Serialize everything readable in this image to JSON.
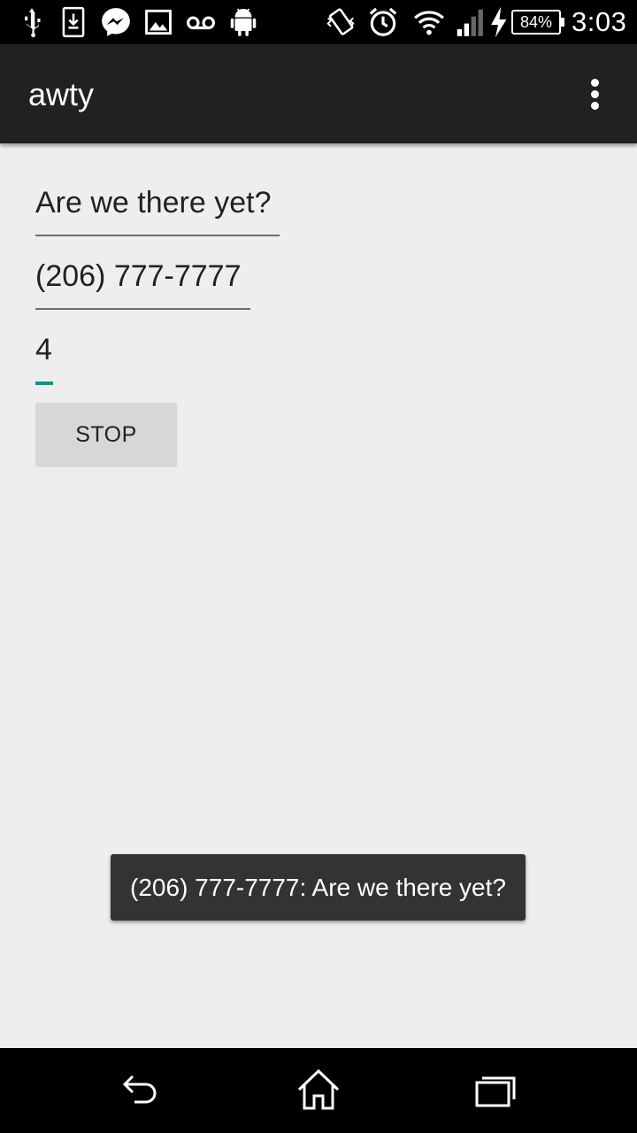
{
  "status_bar": {
    "icons": [
      "usb-icon",
      "download-icon",
      "messenger-icon",
      "gallery-icon",
      "voicemail-icon",
      "android-icon",
      "vibrate-icon",
      "alarm-icon",
      "wifi-icon",
      "signal-icon",
      "charging-icon"
    ],
    "battery": "84%",
    "time": "3:03"
  },
  "app_bar": {
    "title": "awty"
  },
  "form": {
    "message_value": "Are we there yet?",
    "phone_value": "(206) 777-7777",
    "interval_value": "4",
    "stop_label": "STOP"
  },
  "toast": {
    "text": "(206) 777-7777: Are we there yet?"
  },
  "colors": {
    "app_bar": "#212121",
    "background": "#eeeeee",
    "accent": "#009688",
    "button": "#d6d7d7",
    "toast": "#333333"
  }
}
